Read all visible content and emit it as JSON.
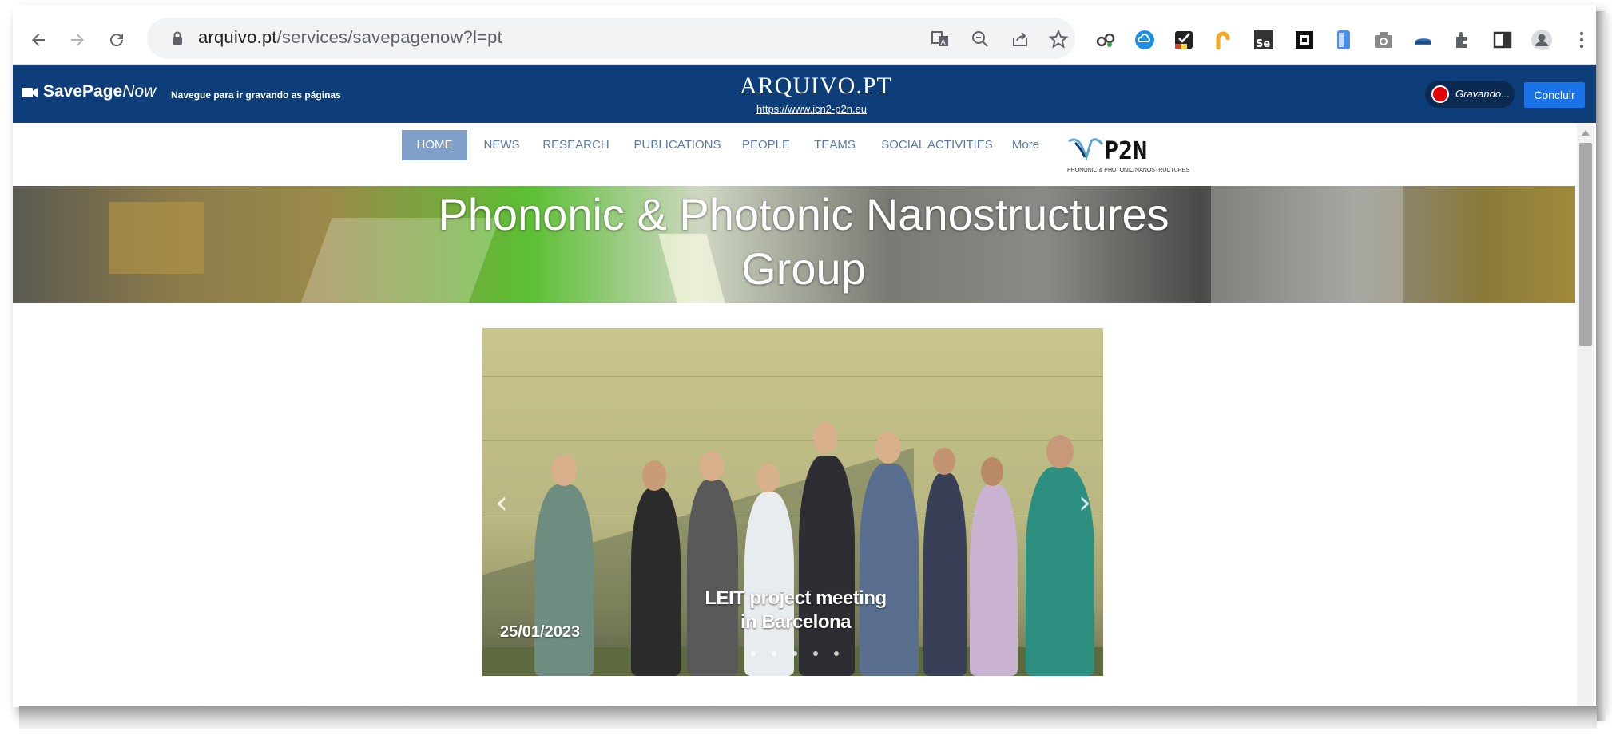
{
  "browser": {
    "url_host": "arquivo.pt",
    "url_path": "/services/savepagenow?l=pt",
    "icons": [
      "back-icon",
      "forward-icon",
      "reload-icon",
      "lock-icon",
      "translate-icon",
      "zoom-out-icon",
      "share-icon",
      "star-icon",
      "extensions-icon",
      "profile-icon",
      "menu-icon"
    ]
  },
  "savepagenow": {
    "brand_bold": "SavePage",
    "brand_italic": "Now",
    "subtitle": "Navegue para ir gravando as páginas",
    "logo": "ARQUIVO.PT",
    "archived_url": "https://www.icn2-p2n.eu",
    "recording_label": "Gravando...",
    "done_label": "Concluir",
    "recording_color": "#e00000",
    "bar_color": "#0e3e79",
    "done_color": "#1a73e8"
  },
  "site": {
    "nav": [
      {
        "label": "HOME",
        "active": true
      },
      {
        "label": "NEWS"
      },
      {
        "label": "RESEARCH"
      },
      {
        "label": "PUBLICATIONS"
      },
      {
        "label": "PEOPLE"
      },
      {
        "label": "TEAMS"
      },
      {
        "label": "SOCIAL ACTIVITIES"
      },
      {
        "label": "More"
      }
    ],
    "logo_text": "P2N",
    "logo_subtext": "PHONONIC & PHOTONIC NANOSTRUCTURES",
    "hero_title_line1": "Phononic & Photonic Nanostructures",
    "hero_title_line2": "Group",
    "slide": {
      "caption_line1": "LEIT project meeting",
      "caption_line2": "in Barcelona",
      "date": "25/01/2023",
      "prev_arrow": "‹",
      "next_arrow": "›",
      "dot_count": 5
    }
  }
}
